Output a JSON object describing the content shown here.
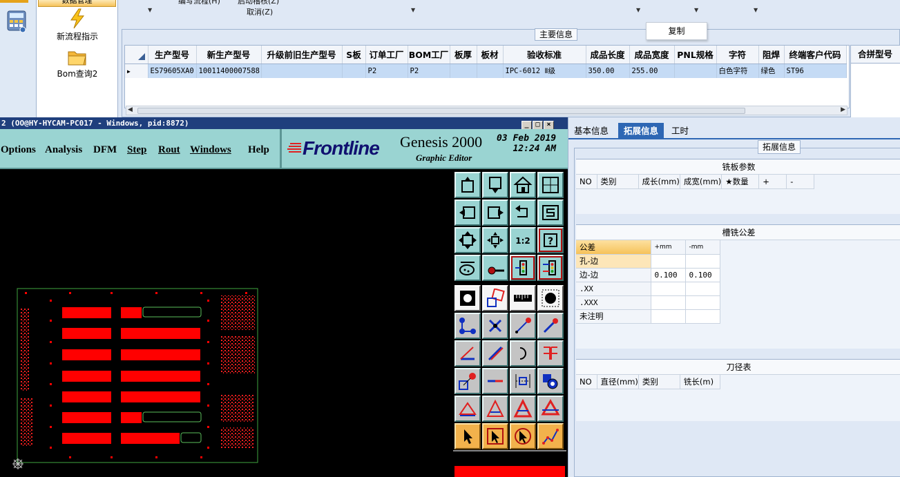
{
  "nav": {
    "top_tab": "数据管理",
    "item1": "新流程指示",
    "item2": "Bom查询2"
  },
  "toolbar": {
    "label1": "编写流程(H)",
    "label2": "启动稽核(Z)",
    "label3": "取消(Z)"
  },
  "main": {
    "group_label": "主要信息",
    "copy_btn": "复制",
    "columns": [
      "生产型号",
      "新生产型号",
      "升级前旧生产型号",
      "S板",
      "订单工厂",
      "BOM工厂",
      "板厚",
      "板材",
      "验收标准",
      "成品长度",
      "成品宽度",
      "PNL规格",
      "字符",
      "阻焊",
      "终端客户代码"
    ],
    "row": [
      "ES79605XA0",
      "10011400007588",
      "",
      "",
      "P2",
      "P2",
      "",
      "",
      "IPC-6012 Ⅱ级",
      "350.00",
      "255.00",
      "",
      "白色字符",
      "绿色",
      "ST96"
    ],
    "merge_col": "合拼型号"
  },
  "genesis": {
    "title": "2 (OO@HY-HYCAM-PC017 - Windows, pid:8872)",
    "menus": [
      "Options",
      "Analysis",
      "DFM",
      "Step",
      "Rout",
      "Windows",
      "Help"
    ],
    "brand": "Frontline",
    "product": "Genesis 2000",
    "subtitle": "Graphic Editor",
    "date": "03 Feb 2019",
    "time": "12:24 AM",
    "tool_text_ratio": "1:2",
    "tool_text_help": "?"
  },
  "right": {
    "tabs": [
      "基本信息",
      "拓展信息",
      "工时"
    ],
    "ext_label": "拓展信息",
    "sec1": {
      "title": "铣板参数",
      "headers": [
        "NO",
        "类别",
        "成长(mm)",
        "成宽(mm)",
        "★数量",
        "+",
        "-"
      ]
    },
    "sec2": {
      "title": "槽铣公差",
      "headers": [
        "公差",
        "+mm",
        "-mm"
      ],
      "rows": [
        [
          "孔-边",
          "",
          ""
        ],
        [
          "边-边",
          "0.100",
          "0.100"
        ],
        [
          ".XX",
          "",
          ""
        ],
        [
          ".XXX",
          "",
          ""
        ],
        [
          "未注明",
          "",
          ""
        ]
      ]
    },
    "sec3": {
      "title": "刀径表",
      "headers": [
        "NO",
        "直径(mm)",
        "类别",
        "铣长(m)"
      ]
    }
  },
  "colors": {
    "accent": "#2e67b4",
    "genesis_teal": "#9ad4d2",
    "pcb_red": "#ff0000"
  }
}
